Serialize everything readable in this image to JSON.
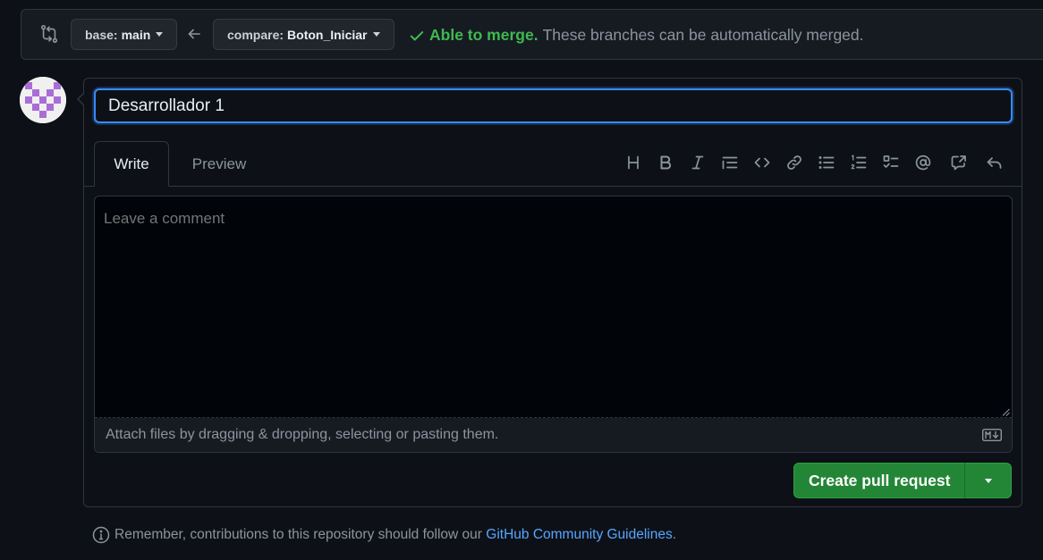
{
  "compare_bar": {
    "base_label": "base:",
    "base_value": "main",
    "compare_label": "compare:",
    "compare_value": "Boton_Iniciar",
    "merge_status": "Able to merge.",
    "merge_description": "These branches can be automatically merged."
  },
  "pr_form": {
    "title_value": "Desarrollador 1",
    "tabs": [
      {
        "label": "Write"
      },
      {
        "label": "Preview"
      }
    ],
    "toolbar_icons": [
      "heading-icon",
      "bold-icon",
      "italic-icon",
      "quote-icon",
      "code-icon",
      "link-icon",
      "bulleted-list-icon",
      "numbered-list-icon",
      "task-list-icon",
      "mention-icon",
      "cross-reference-icon",
      "reply-icon"
    ],
    "comment_placeholder": "Leave a comment",
    "attach_text": "Attach files by dragging & dropping, selecting or pasting them.",
    "markdown_icon": "markdown-icon",
    "create_button": "Create pull request"
  },
  "footer": {
    "note_prefix": "Remember, contributions to this repository should follow our",
    "note_link": "GitHub Community Guidelines",
    "note_suffix": "."
  },
  "colors": {
    "background": "#0d1117",
    "accent_blue": "#388bfd",
    "success_green": "#3fb950",
    "button_green": "#238636",
    "link": "#58a6ff"
  }
}
